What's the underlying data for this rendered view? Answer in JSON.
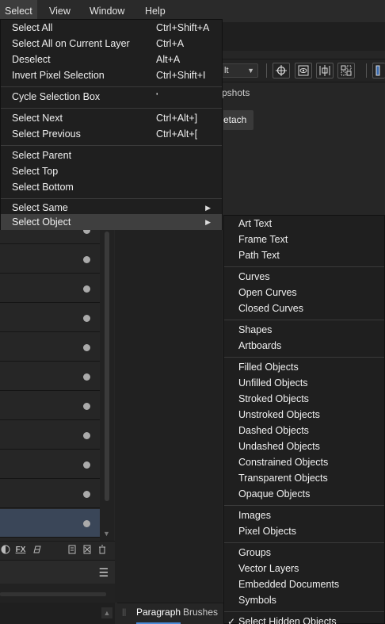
{
  "menubar": {
    "items": [
      {
        "label": "Select",
        "active": true
      },
      {
        "label": "View",
        "active": false
      },
      {
        "label": "Window",
        "active": false
      },
      {
        "label": "Help",
        "active": false
      }
    ]
  },
  "toolbar": {
    "dropdown_value": "lt",
    "icons": [
      "crosshair-icon",
      "eye-box-icon",
      "align-center-icon",
      "grid-select-icon"
    ]
  },
  "context": {
    "tab_label": "pshots",
    "detach_label": "etach"
  },
  "select_menu": {
    "items": [
      {
        "label": "Select All",
        "shortcut": "Ctrl+Shift+A"
      },
      {
        "label": "Select All on Current Layer",
        "shortcut": "Ctrl+A"
      },
      {
        "label": "Deselect",
        "shortcut": "Alt+A"
      },
      {
        "label": "Invert Pixel Selection",
        "shortcut": "Ctrl+Shift+I"
      },
      {
        "label": "Cycle Selection Box",
        "shortcut": "'"
      },
      {
        "label": "Select Next",
        "shortcut": "Ctrl+Alt+]"
      },
      {
        "label": "Select Previous",
        "shortcut": "Ctrl+Alt+["
      },
      {
        "label": "Select Parent",
        "shortcut": ""
      },
      {
        "label": "Select Top",
        "shortcut": ""
      },
      {
        "label": "Select Bottom",
        "shortcut": ""
      },
      {
        "label": "Select Same",
        "shortcut": "",
        "submenu": true
      },
      {
        "label": "Select Object",
        "shortcut": "",
        "submenu": true,
        "highlighted": true
      }
    ]
  },
  "object_menu": {
    "items": [
      {
        "label": "Art Text"
      },
      {
        "label": "Frame Text"
      },
      {
        "label": "Path Text"
      },
      {
        "label": "Curves"
      },
      {
        "label": "Open Curves"
      },
      {
        "label": "Closed Curves"
      },
      {
        "label": "Shapes"
      },
      {
        "label": "Artboards"
      },
      {
        "label": "Filled Objects"
      },
      {
        "label": "Unfilled Objects"
      },
      {
        "label": "Stroked Objects"
      },
      {
        "label": "Unstroked Objects"
      },
      {
        "label": "Dashed Objects"
      },
      {
        "label": "Undashed Objects"
      },
      {
        "label": "Constrained Objects"
      },
      {
        "label": "Transparent Objects"
      },
      {
        "label": "Opaque Objects"
      },
      {
        "label": "Images"
      },
      {
        "label": "Pixel Objects"
      },
      {
        "label": "Groups"
      },
      {
        "label": "Vector Layers"
      },
      {
        "label": "Embedded Documents"
      },
      {
        "label": "Symbols"
      },
      {
        "label": "Select Hidden Objects",
        "checked": true
      }
    ]
  },
  "layers_panel": {
    "row_count": 11,
    "selected_row": 10,
    "footer_icons": [
      "blend-mode-icon",
      "fx-icon",
      "mask-icon",
      "new-layer-icon",
      "delete-layer-icon",
      "trash-icon"
    ]
  },
  "bottom_tabs": {
    "tabs": [
      {
        "label": "Paragraph",
        "active": true
      },
      {
        "label": "Brushes",
        "active": false
      }
    ]
  },
  "colors": {
    "menu_bg": "#1f1f1f",
    "highlight": "#3f3f3f",
    "selected_layer": "#3a4658",
    "accent": "#4a8bd6"
  }
}
